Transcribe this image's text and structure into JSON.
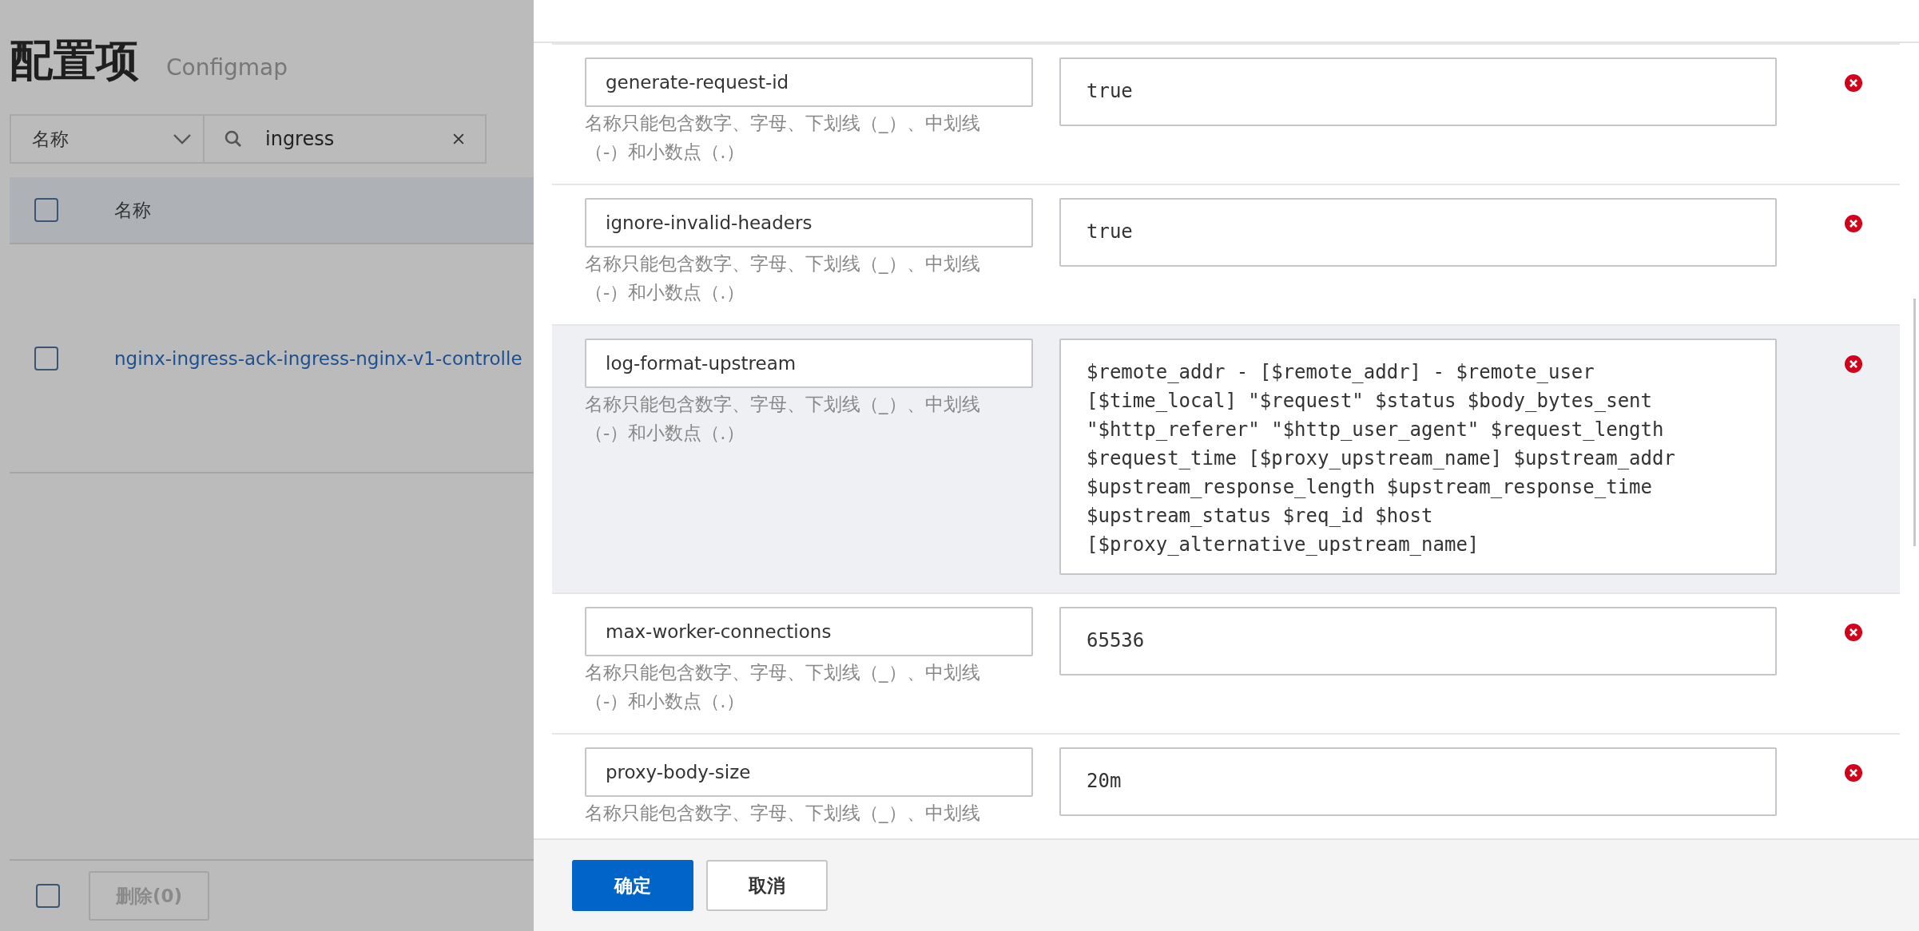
{
  "page": {
    "title": "配置项",
    "subtitle": "Configmap",
    "filter": {
      "field": "名称",
      "value": "ingress"
    },
    "table": {
      "select_all_checked": false,
      "columns": [
        "名称"
      ],
      "rows": [
        {
          "name": "nginx-ingress-ack-ingress-nginx-v1-controlle",
          "checked": false
        }
      ]
    },
    "footer_checked": false,
    "delete_button": "删除(0)"
  },
  "drawer": {
    "entries": [
      {
        "key": "generate-request-id",
        "hint": "名称只能包含数字、字母、下划线（_）、中划线（-）和小数点（.）",
        "value": "true",
        "highlighted": false
      },
      {
        "key": "ignore-invalid-headers",
        "hint": "名称只能包含数字、字母、下划线（_）、中划线（-）和小数点（.）",
        "value": "true",
        "highlighted": false
      },
      {
        "key": "log-format-upstream",
        "hint": "名称只能包含数字、字母、下划线（_）、中划线（-）和小数点（.）",
        "value": "$remote_addr - [$remote_addr] - $remote_user [$time_local] \"$request\" $status $body_bytes_sent \"$http_referer\" \"$http_user_agent\" $request_length $request_time [$proxy_upstream_name] $upstream_addr $upstream_response_length $upstream_response_time $upstream_status $req_id $host [$proxy_alternative_upstream_name]",
        "highlighted": true
      },
      {
        "key": "max-worker-connections",
        "hint": "名称只能包含数字、字母、下划线（_）、中划线（-）和小数点（.）",
        "value": "65536",
        "highlighted": false
      },
      {
        "key": "proxy-body-size",
        "hint": "名称只能包含数字、字母、下划线（_）、中划线",
        "value": "20m",
        "highlighted": false
      }
    ],
    "buttons": [
      {
        "label": "确定",
        "kind": "primary"
      },
      {
        "label": "取消",
        "kind": "default"
      }
    ]
  }
}
